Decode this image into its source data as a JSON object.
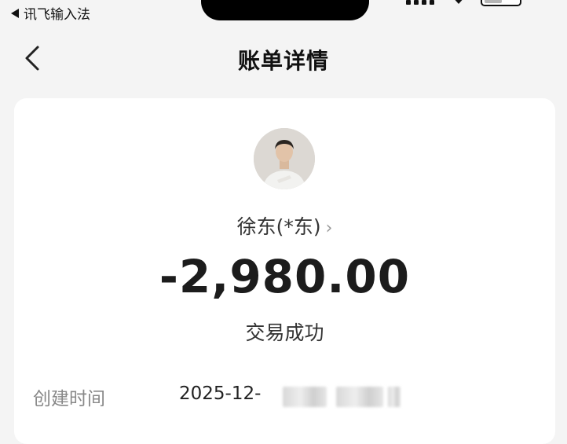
{
  "status_bar": {
    "back_app_label": "讯飞输入法"
  },
  "nav": {
    "title": "账单详情"
  },
  "bill": {
    "payee": "徐东(*东)",
    "amount": "-2,980.00",
    "status": "交易成功",
    "details": [
      {
        "label": "创建时间",
        "value": "2025-12-"
      }
    ]
  }
}
